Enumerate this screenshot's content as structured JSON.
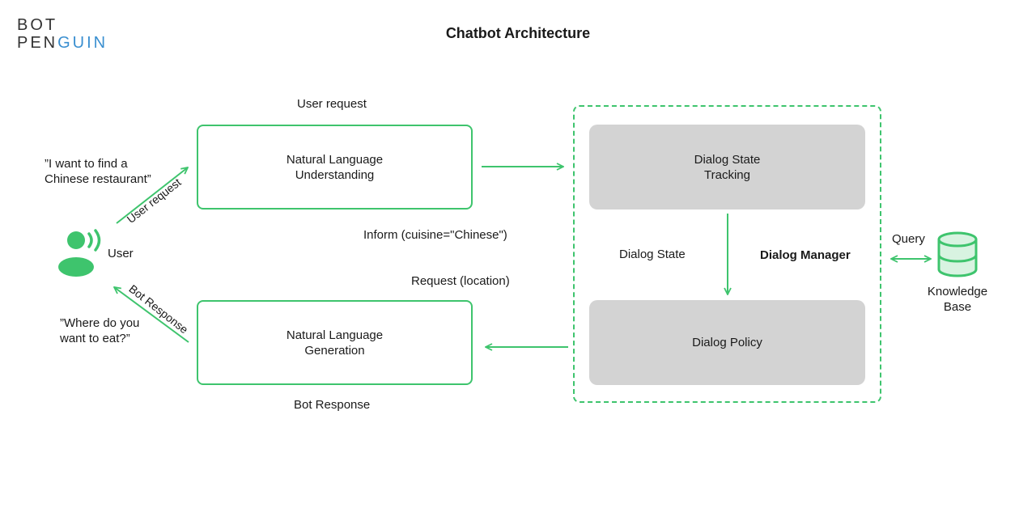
{
  "brand": {
    "line1": "BOT",
    "line2_a": "PEN",
    "line2_b": "GUIN"
  },
  "title": "Chatbot Architecture",
  "colors": {
    "accent": "#3ec46d",
    "grey_box": "#d3d3d3",
    "brand_blue": "#3a8fd0"
  },
  "user": {
    "label": "User",
    "quote_request": "”I want to find a Chinese restaurant”",
    "quote_request_line1": "”I want to find a",
    "quote_request_line2": "Chinese restaurant”",
    "quote_response_line1": "”Where do you",
    "quote_response_line2": "want to eat?”",
    "arrow_up_label": "User request",
    "arrow_down_label": "Bot Response"
  },
  "nlu": {
    "line1": "Natural Language",
    "line2": "Understanding",
    "top_label": "User request"
  },
  "nlg": {
    "line1": "Natural Language",
    "line2": "Generation",
    "bottom_label": "Bot Response"
  },
  "messages": {
    "inform": "Inform (cuisine=\"Chinese\")",
    "request": "Request (location)"
  },
  "dialog_manager": {
    "label": "Dialog Manager",
    "dst_line1": "Dialog State",
    "dst_line2": "Tracking",
    "state_label": "Dialog State",
    "policy": "Dialog Policy"
  },
  "knowledge_base": {
    "query_label": "Query",
    "line1": "Knowledge",
    "line2": "Base"
  }
}
